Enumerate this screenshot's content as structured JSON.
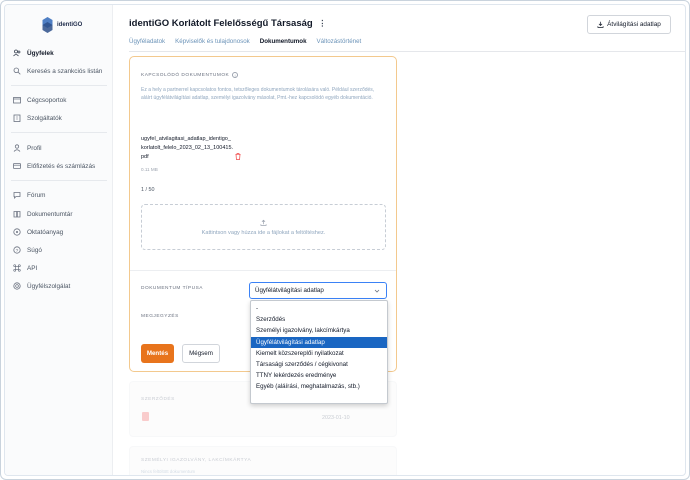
{
  "app": {
    "logo_text": "identiGO"
  },
  "sidebar": {
    "items": [
      {
        "label": "Ügyfelek",
        "icon": "users-icon"
      },
      {
        "label": "Keresés a szankciós listán",
        "icon": "search-icon"
      },
      {
        "label": "Cégcsoportok",
        "icon": "folder-icon"
      },
      {
        "label": "Szolgáltatók",
        "icon": "building-icon"
      },
      {
        "label": "Profil",
        "icon": "user-icon"
      },
      {
        "label": "Előfizetés és számlázás",
        "icon": "card-icon"
      },
      {
        "label": "Fórum",
        "icon": "chat-icon"
      },
      {
        "label": "Dokumentumtár",
        "icon": "book-icon"
      },
      {
        "label": "Oktatóanyag",
        "icon": "graduation-icon"
      },
      {
        "label": "Súgó",
        "icon": "help-icon"
      },
      {
        "label": "API",
        "icon": "command-icon"
      },
      {
        "label": "Ügyfélszolgálat",
        "icon": "support-icon"
      }
    ]
  },
  "header": {
    "title": "identiGO Korlátolt Felelősségű Társaság",
    "menu_glyph": "⋮",
    "action_button": "Átvilágítási adatlap"
  },
  "tabs": [
    {
      "label": "Ügyféladatok"
    },
    {
      "label": "Képviselők és tulajdonosok"
    },
    {
      "label": "Dokumentumok"
    },
    {
      "label": "Változástörténet"
    }
  ],
  "card": {
    "section_title": "KAPCSOLÓDÓ DOKUMENTUMOK",
    "description": "Ez a hely a partnerrel kapcsolatos fontos, tetszőleges dokumentumok tárolására való. Például szerződés, aláírt ügyfélátvilágítási adatlap, személyi igazolvány másolat, Pmt.-hez kapcsolódó egyéb dokumentáció.",
    "file_name_line1": "ugyfel_atvilagitasi_adatlap_identigo_",
    "file_name_line2": "korlatolt_felelo_2023_02_13_100415.",
    "file_name_line3": "pdf",
    "file_size": "0.11 MB",
    "count": "1 / 50",
    "dropzone_text": "Kattintson vagy húzza ide a fájlokat a feltöltéshez.",
    "type_label": "DOKUMENTUM TÍPUSA",
    "type_value": "Ügyfélátvilágítási adatlap",
    "note_label": "MEGJEGYZÉS",
    "save_button": "Mentés",
    "cancel_button": "Mégsem"
  },
  "ghost_cards": {
    "first_title": "SZERZŐDÉS",
    "first_date": "2023-01-10",
    "second_title": "SZEMÉLYI IGAZOLVÁNY, LAKCÍMKÁRTYA",
    "second_sub": "Nincs feltöltött dokumentum"
  },
  "dropdown": {
    "options": [
      "-",
      "Szerződés",
      "Személyi igazolvány, lakcímkártya",
      "Ügyfélátvilágítási adatlap",
      "Kiemelt közszereplői nyilatkozat",
      "Társasági szerződés / cégkivonat",
      "TTNY lekérdezés eredménye",
      "Egyéb (aláírási, meghatalmazás, stb.)"
    ],
    "selected_index": 3
  },
  "colors": {
    "accent": "#e8741c",
    "selection": "#1a66c2",
    "border_highlight": "#f3c98e",
    "link": "#6b93b8"
  }
}
